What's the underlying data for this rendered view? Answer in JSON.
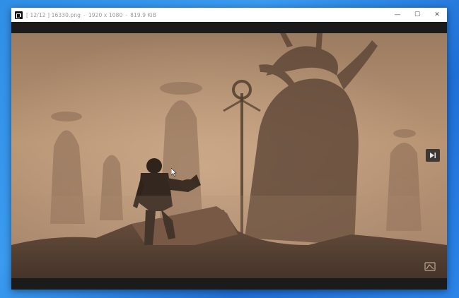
{
  "window": {
    "index_label": "[ 12/12 ]",
    "file_name": "16330.png",
    "dimensions": "1920 x 1080",
    "file_size": "819.9 KiB",
    "separator": "-"
  },
  "controls": {
    "minimize": "—",
    "maximize": "☐",
    "close": "✕"
  },
  "icons": {
    "app": "image-viewer-icon",
    "next": "next-image-icon",
    "watermark": "watermark-logo-icon"
  }
}
